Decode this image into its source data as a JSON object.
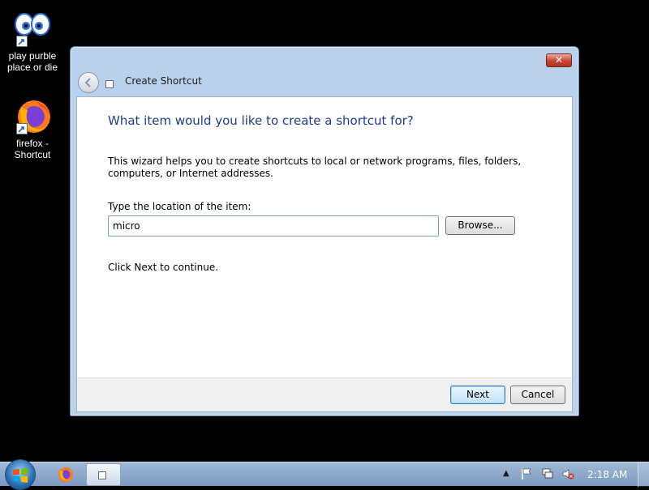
{
  "desktop": {
    "icons": [
      {
        "label_line1": "play purble",
        "label_line2": "place or die"
      },
      {
        "label_line1": "firefox -",
        "label_line2": "Shortcut"
      }
    ]
  },
  "window": {
    "title": "Create Shortcut",
    "close_label": "✕",
    "heading": "What item would you like to create a shortcut for?",
    "description": "This wizard helps you to create shortcuts to local or network programs, files, folders, computers, or Internet addresses.",
    "location_label": "Type the location of the item:",
    "location_value": "micro",
    "browse_label": "Browse...",
    "continue_text": "Click Next to continue.",
    "next_label": "Next",
    "cancel_label": "Cancel"
  },
  "taskbar": {
    "clock": "2:18 AM"
  },
  "colors": {
    "heading": "#1c3c8c",
    "window_frame": "#b9d1ea",
    "close_button": "#c9452f",
    "taskbar": "#8aa8cc"
  }
}
